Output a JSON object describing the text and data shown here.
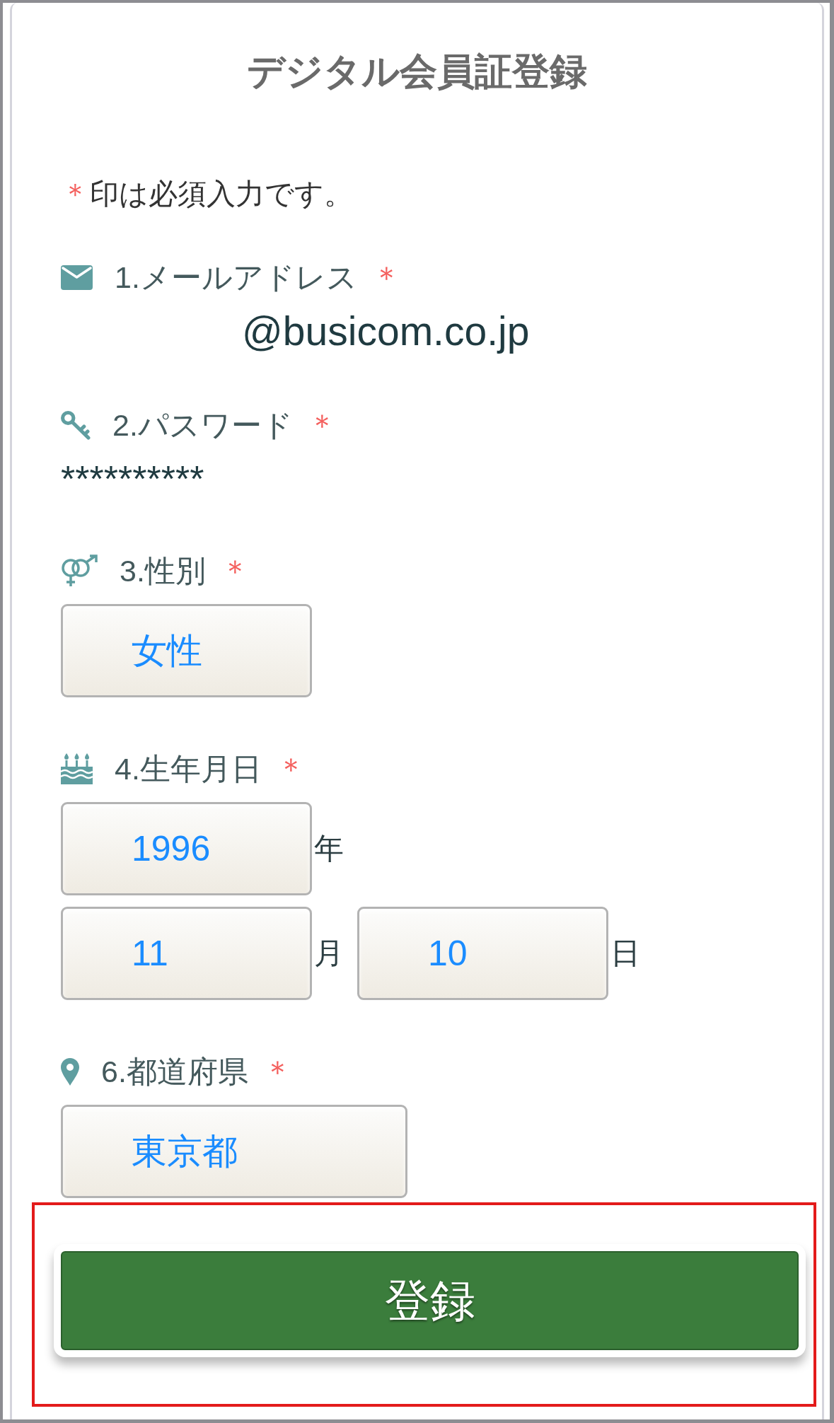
{
  "screen": {
    "title": "デジタル会員証登録"
  },
  "required_note": {
    "mark": "＊",
    "text": "印は必須入力です。"
  },
  "fields": [
    {
      "kind": "email",
      "label": "1.メールアドレス",
      "required_mark": "＊",
      "value": "@busicom.co.jp"
    },
    {
      "kind": "password",
      "label": "2.パスワード",
      "required_mark": "＊",
      "value": "**********"
    },
    {
      "kind": "select",
      "label": "3.性別",
      "required_mark": "＊",
      "value": "女性"
    },
    {
      "kind": "date",
      "label": "4.生年月日",
      "required_mark": "＊",
      "parts": [
        {
          "value": "1996",
          "unit": "年"
        },
        {
          "value": "11",
          "unit": "月"
        },
        {
          "value": "10",
          "unit": "日"
        }
      ]
    },
    {
      "kind": "select",
      "label": "6.都道府県",
      "required_mark": "＊",
      "value": "東京都"
    }
  ],
  "submit": {
    "label": "登録",
    "highlighted": true
  }
}
